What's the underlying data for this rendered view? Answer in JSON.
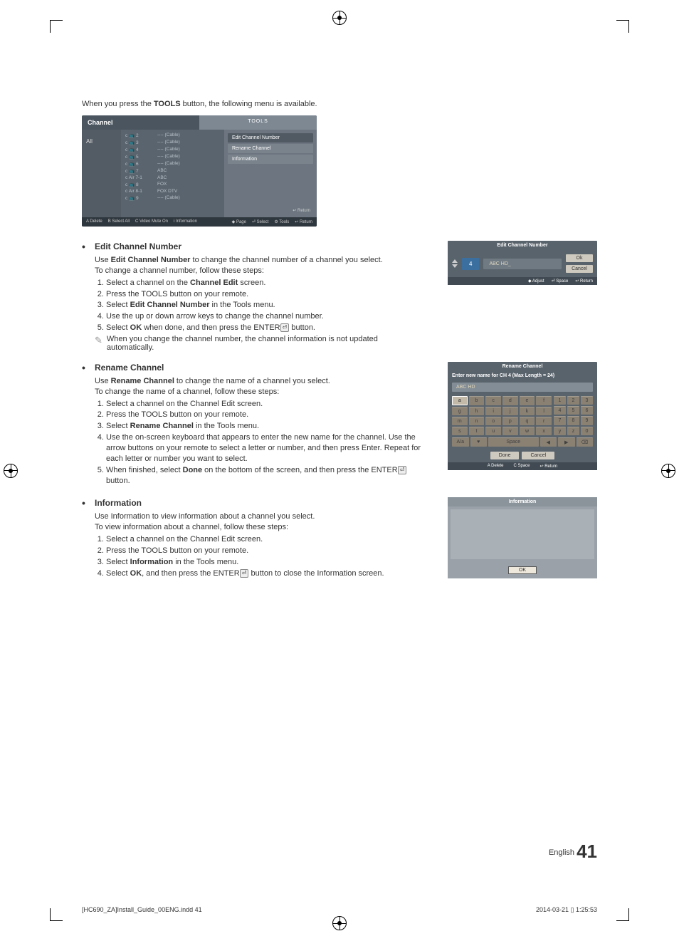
{
  "intro": {
    "pre": "When you press the ",
    "tools": "TOOLS",
    "post": " button, the following menu is available."
  },
  "ss": {
    "title": "Channel",
    "toolsTab": "TOOLS",
    "all": "All",
    "rows": [
      {
        "ch": "c 📺 2",
        "name": "---- (Cable)"
      },
      {
        "ch": "c 📺 3",
        "name": "---- (Cable)"
      },
      {
        "ch": "c 📺 4",
        "name": "---- (Cable)"
      },
      {
        "ch": "c 📺 5",
        "name": "---- (Cable)"
      },
      {
        "ch": "c 📺 6",
        "name": "---- (Cable)"
      },
      {
        "ch": "c 📺 7",
        "name": "ABC"
      },
      {
        "ch": "c Air 7-1",
        "name": "ABC"
      },
      {
        "ch": "c 📺 8",
        "name": "FOX"
      },
      {
        "ch": "c Air 8-1",
        "name": "FOX DTV"
      },
      {
        "ch": "c 📺 9",
        "name": "---- (Cable)"
      }
    ],
    "menu": {
      "m1": "Edit Channel Number",
      "m2": "Rename Channel",
      "m3": "Information",
      "ret": "↩ Return"
    },
    "tb": {
      "a": "A Delete",
      "b": "B Select All",
      "c": "C Video Mute On",
      "d": "i Information",
      "e": "◆ Page",
      "f": "⏎ Select",
      "g": "⚙ Tools",
      "h": "↩ Return"
    }
  },
  "sec1": {
    "h": "Edit Channel Number",
    "p1a": "Use ",
    "p1b": "Edit Channel Number",
    "p1c": " to change the channel number of a channel you select.",
    "p2": "To change a channel number, follow these steps:",
    "s1a": "Select a channel on the ",
    "s1b": "Channel Edit",
    "s1c": " screen.",
    "s2": "Press the TOOLS button on your remote.",
    "s3a": "Select ",
    "s3b": "Edit Channel Number",
    "s3c": " in the Tools menu.",
    "s4": "Use the up or down arrow keys to change the channel number.",
    "s5a": "Select ",
    "s5b": "OK",
    "s5c": " when done, and then press the ENTER",
    "s5d": " button.",
    "note": "When you change the channel number, the channel information is not updated automatically."
  },
  "panel1": {
    "title": "Edit Channel Number",
    "num": "4",
    "name": "ABC HD_",
    "ok": "Ok",
    "cancel": "Cancel",
    "f1": "◆ Adjust",
    "f2": "⏎ Space",
    "f3": "↩ Return"
  },
  "sec2": {
    "h": "Rename Channel",
    "p1a": "Use ",
    "p1b": "Rename Channel",
    "p1c": " to change the name of a channel you select.",
    "p2": "To change the name of a channel, follow these steps:",
    "s1": "Select a channel on the Channel Edit screen.",
    "s2": "Press the TOOLS button on your remote.",
    "s3a": "Select ",
    "s3b": "Rename Channel",
    "s3c": " in the Tools menu.",
    "s4": "Use the on-screen keyboard that appears to enter the new name for the channel. Use the arrow buttons on your remote to select a letter or number, and then press Enter. Repeat for each letter or number you want to select.",
    "s5a": "When finished, select ",
    "s5b": "Done",
    "s5c": " on the bottom of the screen, and then press the ENTER",
    "s5d": " button."
  },
  "panel2": {
    "title": "Rename Channel",
    "prompt": "Enter new name for CH 4 (Max Length = 24)",
    "inp": "ABC HD",
    "keys": [
      "a",
      "b",
      "c",
      "d",
      "e",
      "f",
      "g",
      "h",
      "i",
      "j",
      "k",
      "l",
      "m",
      "n",
      "o",
      "p",
      "q",
      "r",
      "s",
      "t",
      "u",
      "v",
      "w",
      "x"
    ],
    "nums": [
      "1",
      "2",
      "3",
      "4",
      "5",
      "6",
      "7",
      "8",
      "9",
      "y",
      "z",
      "0"
    ],
    "row5": {
      "a": "A/a",
      "b": "♥",
      "space": "Space",
      "l": "◀",
      "r": "▶",
      "del": "⌫"
    },
    "done": "Done",
    "cancel": "Cancel",
    "f1": "A Delete",
    "f2": "C Space",
    "f3": "↩ Return"
  },
  "sec3": {
    "h": "Information",
    "p1": "Use Information to view information about a channel you select.",
    "p2": "To view information about a channel, follow these steps:",
    "s1": "Select a channel on the Channel Edit screen.",
    "s2": "Press the TOOLS button on your remote.",
    "s3a": "Select ",
    "s3b": "Information",
    "s3c": " in the Tools menu.",
    "s4a": "Select ",
    "s4b": "OK",
    "s4c": ", and then press the ENTER",
    "s4d": " button to close the Information screen."
  },
  "panel3": {
    "title": "Information",
    "ok": "OK"
  },
  "footer": {
    "lang": "English",
    "page": "41"
  },
  "meta": {
    "file": "[HC690_ZA]Install_Guide_00ENG.indd   41",
    "ts": "2014-03-21   ▯ 1:25:53"
  },
  "enterGlyph": "⏎"
}
